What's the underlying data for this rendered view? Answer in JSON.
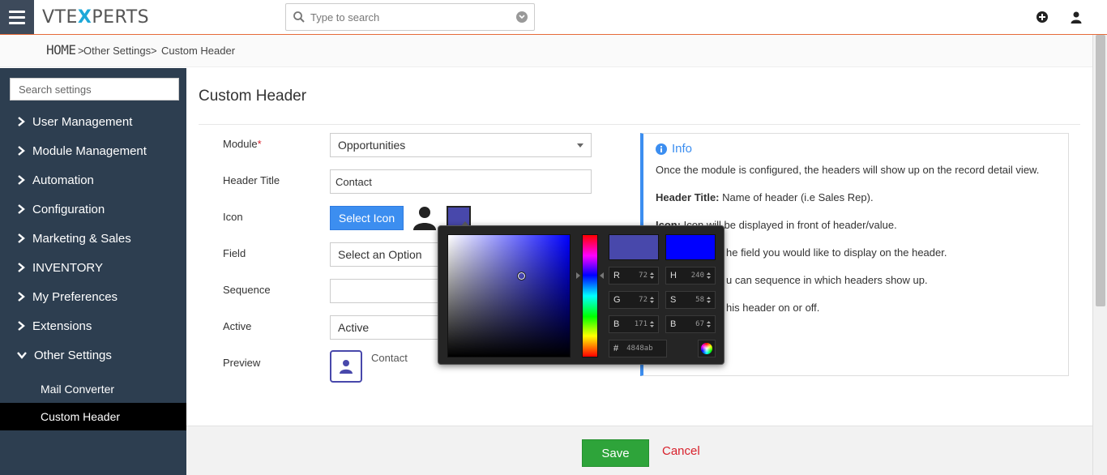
{
  "brand": {
    "logo_left": "VTE",
    "logo_x": "X",
    "logo_right": "PERTS"
  },
  "search": {
    "placeholder": "Type to search"
  },
  "breadcrumb": {
    "home": "HOME",
    "sep": ">",
    "item1": "Other Settings",
    "item2": "Custom Header"
  },
  "sidebar": {
    "search_placeholder": "Search settings",
    "items": [
      {
        "label": "User Management"
      },
      {
        "label": "Module Management"
      },
      {
        "label": "Automation"
      },
      {
        "label": "Configuration"
      },
      {
        "label": "Marketing & Sales"
      },
      {
        "label": "INVENTORY"
      },
      {
        "label": "My Preferences"
      },
      {
        "label": "Extensions"
      },
      {
        "label": "Other Settings"
      }
    ],
    "subitems": [
      {
        "label": "Mail Converter"
      },
      {
        "label": "Custom Header"
      }
    ]
  },
  "form": {
    "title": "Custom Header",
    "module_label": "Module",
    "required_mark": "*",
    "module_value": "Opportunities",
    "header_title_label": "Header Title",
    "header_title_value": "Contact",
    "icon_label": "Icon",
    "select_icon_button": "Select Icon",
    "field_label": "Field",
    "field_value": "Select an Option",
    "sequence_label": "Sequence",
    "sequence_value": "",
    "active_label": "Active",
    "active_value": "Active",
    "preview_label": "Preview",
    "preview_text": "Contact"
  },
  "info": {
    "heading": "Info",
    "line1": "Once the module is configured, the headers will show up on the record detail view.",
    "line2_bold": "Header Title:",
    "line2_rest": " Name of header (i.e Sales Rep).",
    "line3_bold": "Icon:",
    "line3_rest": " Icon will be displayed in front of header/value.",
    "line4": "he field you would like to display on the header.",
    "line5": "u can sequence in which headers show up.",
    "line6": "his header on or off."
  },
  "colorpicker": {
    "current_color": "#4848ab",
    "new_color": "#0000ff",
    "r_label": "R",
    "r": "72",
    "g_label": "G",
    "g": "72",
    "b_label": "B",
    "b": "171",
    "h_label": "H",
    "h": "240",
    "s_label": "S",
    "s": "58",
    "v_label": "B",
    "v": "67",
    "hex_label": "#",
    "hex": "4848ab"
  },
  "footer": {
    "save": "Save",
    "cancel": "Cancel"
  },
  "colors": {
    "accent": "#3c8ef0",
    "sidebar_bg": "#2d3e50",
    "save_green": "#2ea43a",
    "cancel_red": "#d8202b",
    "topline": "#e66b3a"
  }
}
